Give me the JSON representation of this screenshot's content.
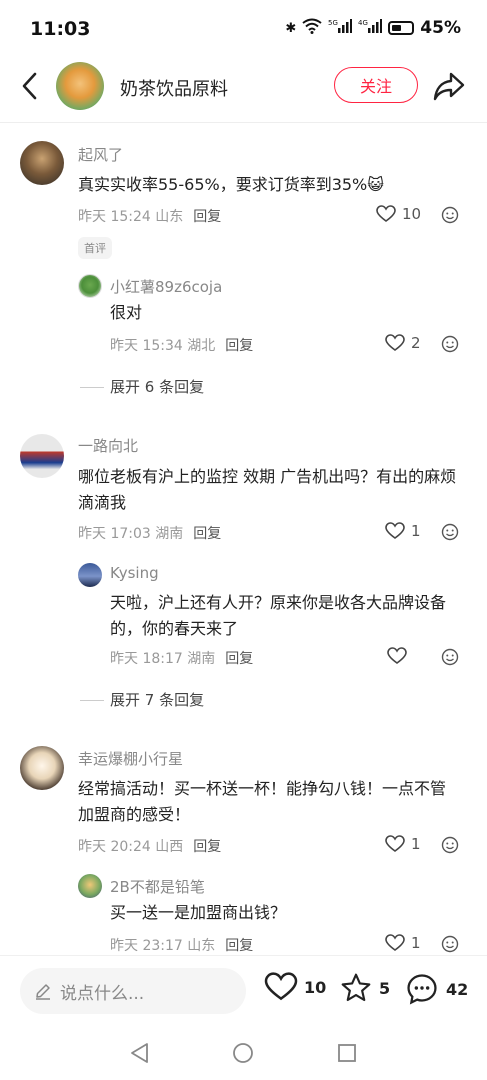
{
  "status": {
    "time": "11:03",
    "battery": "45%"
  },
  "header": {
    "title": "奶茶饮品原料",
    "follow": "关注"
  },
  "comments": [
    {
      "user": "起风了",
      "text": "真实实收率55-65%，要求订货率到35%😺",
      "time": "昨天 15:24 山东",
      "reply": "回复",
      "likes": "10",
      "badge": "首评"
    },
    {
      "user": "小红薯89z6coja",
      "text": "很对",
      "time": "昨天 15:34 湖北",
      "reply": "回复",
      "likes": "2"
    },
    {
      "expand": "展开 6 条回复"
    },
    {
      "user": "一路向北",
      "text": "哪位老板有沪上的监控 效期 广告机出吗？有出的麻烦滴滴我",
      "time": "昨天 17:03 湖南",
      "reply": "回复",
      "likes": "1"
    },
    {
      "user": "Kysing",
      "text": "天啦，沪上还有人开？原来你是收各大品牌设备的，你的春天来了",
      "time": "昨天 18:17 湖南",
      "reply": "回复",
      "likes": ""
    },
    {
      "expand": "展开 7 条回复"
    },
    {
      "user": "幸运爆棚小行星",
      "text": "经常搞活动！买一杯送一杯！能挣勾八钱！一点不管加盟商的感受！",
      "time": "昨天 20:24 山西",
      "reply": "回复",
      "likes": "1"
    },
    {
      "user": "2B不都是铅笔",
      "text": "买一送一是加盟商出钱？",
      "time": "昨天 23:17 山东",
      "reply": "回复",
      "likes": "1"
    }
  ],
  "bottom": {
    "placeholder": "说点什么...",
    "likes": "10",
    "stars": "5",
    "comments": "42"
  }
}
